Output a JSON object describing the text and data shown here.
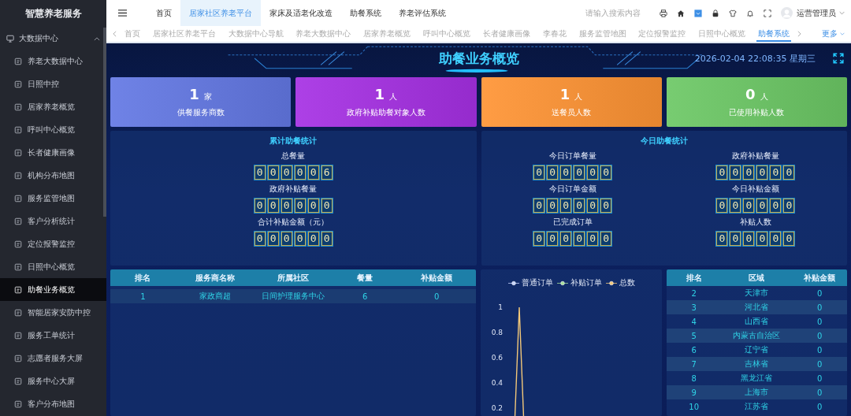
{
  "sidebar": {
    "title": "智慧养老服务",
    "group": {
      "label": "大数据中心",
      "expanded": true
    },
    "items": [
      {
        "label": "养老大数据中心",
        "selected": false
      },
      {
        "label": "日照中控",
        "selected": false
      },
      {
        "label": "居家养老概览",
        "selected": false
      },
      {
        "label": "呼叫中心概览",
        "selected": false
      },
      {
        "label": "长者健康画像",
        "selected": false
      },
      {
        "label": "机构分布地图",
        "selected": false
      },
      {
        "label": "服务监管地图",
        "selected": false
      },
      {
        "label": "客户分析统计",
        "selected": false
      },
      {
        "label": "定位报警监控",
        "selected": false
      },
      {
        "label": "日照中心概览",
        "selected": false
      },
      {
        "label": "助餐业务概览",
        "selected": true
      },
      {
        "label": "智能居家安防中控",
        "selected": false
      },
      {
        "label": "服务工单统计",
        "selected": false
      },
      {
        "label": "志愿者服务大屏",
        "selected": false
      },
      {
        "label": "服务中心大屏",
        "selected": false
      },
      {
        "label": "客户分布地图",
        "selected": false
      }
    ]
  },
  "top_nav": [
    {
      "label": "首页",
      "selected": false
    },
    {
      "label": "居家社区养老平台",
      "selected": true
    },
    {
      "label": "家床及适老化改造",
      "selected": false
    },
    {
      "label": "助餐系统",
      "selected": false
    },
    {
      "label": "养老评估系统",
      "selected": false
    }
  ],
  "search": {
    "placeholder": "请输入搜索内容"
  },
  "user": {
    "name": "运营管理员"
  },
  "page_tabs": [
    {
      "label": "首页",
      "selected": false
    },
    {
      "label": "居家社区养老平台",
      "selected": false
    },
    {
      "label": "大数据中心导航",
      "selected": false
    },
    {
      "label": "养老大数据中心",
      "selected": false
    },
    {
      "label": "居家养老概览",
      "selected": false
    },
    {
      "label": "呼叫中心概览",
      "selected": false
    },
    {
      "label": "长者健康画像",
      "selected": false
    },
    {
      "label": "李春花",
      "selected": false
    },
    {
      "label": "服务监管地图",
      "selected": false
    },
    {
      "label": "定位报警监控",
      "selected": false
    },
    {
      "label": "日照中心概览",
      "selected": false
    },
    {
      "label": "助餐系统",
      "selected": true
    }
  ],
  "more_label": "更多",
  "dashboard": {
    "title": "助餐业务概览",
    "datetime": "2026-02-04 22:08:35 星期三",
    "stats": [
      {
        "value": "1",
        "unit": "家",
        "label": "供餐服务商数",
        "color": "#6378e4"
      },
      {
        "value": "1",
        "unit": "人",
        "label": "政府补贴助餐对象人数",
        "color": "#a630e4"
      },
      {
        "value": "1",
        "unit": "人",
        "label": "送餐员人数",
        "color": "#ff9434"
      },
      {
        "value": "0",
        "unit": "人",
        "label": "已使用补贴人数",
        "color": "#6cc865"
      }
    ],
    "cumulative": {
      "title": "累计助餐统计",
      "counters": [
        {
          "label": "总餐量",
          "digits": [
            "0",
            "0",
            "0",
            "0",
            "0",
            "6"
          ]
        },
        {
          "label": "政府补贴餐量",
          "digits": [
            "0",
            "0",
            "0",
            "0",
            "0",
            "0"
          ]
        },
        {
          "label": "合计补贴金额（元）",
          "digits": [
            "0",
            "0",
            "0",
            "0",
            "0",
            "0"
          ]
        }
      ]
    },
    "today": {
      "title": "今日助餐统计",
      "counters": [
        {
          "label": "今日订单餐量",
          "digits": [
            "0",
            "0",
            "0",
            "0",
            "0",
            "0"
          ]
        },
        {
          "label": "政府补贴餐量",
          "digits": [
            "0",
            "0",
            "0",
            "0",
            "0",
            "0"
          ]
        },
        {
          "label": "今日订单金额",
          "digits": [
            "0",
            "0",
            "0",
            "0",
            "0",
            "0"
          ]
        },
        {
          "label": "今日补贴金额",
          "digits": [
            "0",
            "0",
            "0",
            "0",
            "0",
            "0"
          ]
        },
        {
          "label": "已完成订单",
          "digits": [
            "0",
            "0",
            "0",
            "0",
            "0",
            "0"
          ]
        },
        {
          "label": "补贴人数",
          "digits": [
            "0",
            "0",
            "0",
            "0",
            "0",
            "0"
          ]
        }
      ]
    },
    "provider_table": {
      "columns": [
        "排名",
        "服务商名称",
        "所属社区",
        "餐量",
        "补贴金额"
      ],
      "rows": [
        [
          "1",
          "家政商超",
          "日间护理服务中心",
          "6",
          "0"
        ]
      ]
    },
    "order_chart": {
      "legend": [
        {
          "name": "普通订单",
          "color": "#c8d6ff"
        },
        {
          "name": "补贴订单",
          "color": "#a8e29a"
        },
        {
          "name": "总数",
          "color": "#f3c879"
        }
      ],
      "y_axis_labels": [
        "1",
        "0.8",
        "0.6",
        "0.4",
        "0.2"
      ]
    },
    "region_table": {
      "columns": [
        "排名",
        "区域",
        "补贴金额"
      ],
      "rows": [
        [
          "2",
          "天津市",
          "0"
        ],
        [
          "3",
          "河北省",
          "0"
        ],
        [
          "4",
          "山西省",
          "0"
        ],
        [
          "5",
          "内蒙古自治区",
          "0"
        ],
        [
          "6",
          "辽宁省",
          "0"
        ],
        [
          "7",
          "吉林省",
          "0"
        ],
        [
          "8",
          "黑龙江省",
          "0"
        ],
        [
          "9",
          "上海市",
          "0"
        ],
        [
          "10",
          "江苏省",
          "0"
        ]
      ]
    }
  }
}
